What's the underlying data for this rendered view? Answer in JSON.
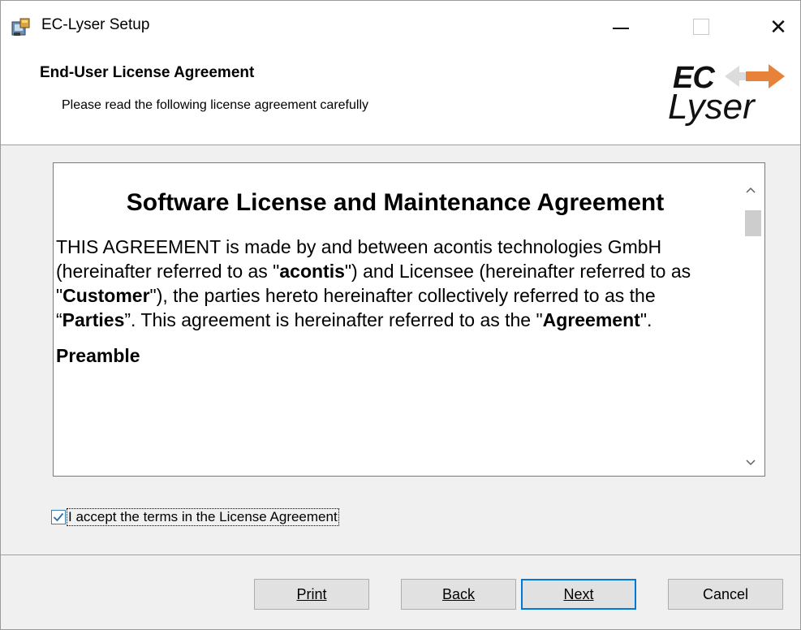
{
  "window": {
    "title": "EC-Lyser Setup",
    "minimize_icon": "minimize-icon",
    "maximize_icon": "maximize-icon",
    "close_symbol": "✕"
  },
  "header": {
    "title": "End-User License Agreement",
    "subtitle": "Please read the following license agreement carefully",
    "logo_line1": "EC",
    "logo_line2": "Lyser",
    "logo_arrow_color": "#e8823a"
  },
  "license": {
    "heading": "Software License and Maintenance Agreement",
    "para": [
      {
        "t": "THIS AGREEMENT is made by and between acontis technologies GmbH (hereinafter referred to as \"",
        "b": false
      },
      {
        "t": "acontis",
        "b": true
      },
      {
        "t": "\") and Licensee (hereinafter referred to as \"",
        "b": false
      },
      {
        "t": "Customer",
        "b": true
      },
      {
        "t": "\"), the parties hereto hereinafter collectively referred to as the “",
        "b": false
      },
      {
        "t": "Parties",
        "b": true
      },
      {
        "t": "”. This agreement is hereinafter referred to as the \"",
        "b": false
      },
      {
        "t": "Agreement",
        "b": true
      },
      {
        "t": "\".",
        "b": false
      }
    ],
    "section": "Preamble",
    "scroll_up": "^",
    "scroll_down": "v"
  },
  "accept": {
    "label": "I accept the terms in the License Agreement",
    "checked": true
  },
  "buttons": {
    "print": "Print",
    "back": "Back",
    "next": "Next",
    "cancel": "Cancel"
  },
  "colors": {
    "focus_border": "#0078d7",
    "checkbox_border": "#3c7fb1"
  }
}
